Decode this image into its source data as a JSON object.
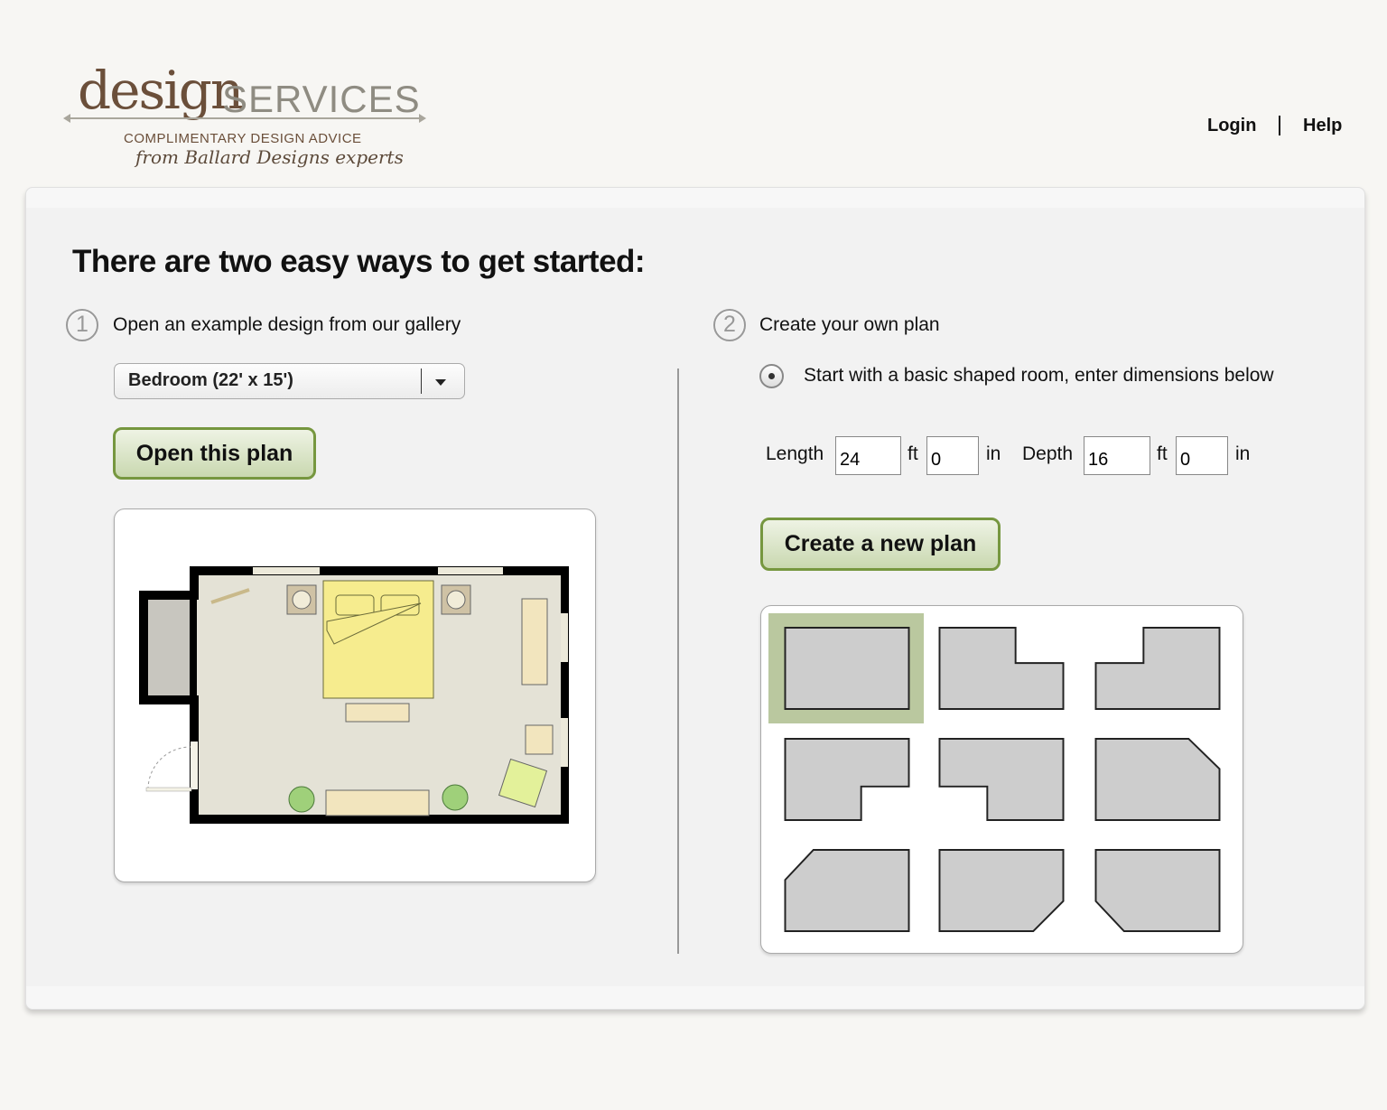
{
  "header": {
    "logo": {
      "word1": "design",
      "word2": "SERVICES",
      "tagline": "COMPLIMENTARY DESIGN ADVICE",
      "from": "from Ballard Designs experts"
    },
    "login": "Login",
    "help": "Help"
  },
  "main": {
    "title": "There are two easy ways to get started:",
    "option1": {
      "number": "1",
      "label": "Open an example design from our gallery",
      "select_value": "Bedroom (22' x 15')",
      "button": "Open this plan"
    },
    "option2": {
      "number": "2",
      "label": "Create your own plan",
      "radio_label": "Start with a basic shaped room, enter dimensions below",
      "length_label": "Length",
      "length_ft": "24",
      "length_in": "0",
      "depth_label": "Depth",
      "depth_ft": "16",
      "depth_in": "0",
      "ft": "ft",
      "in": "in",
      "button": "Create a new plan",
      "shapes": [
        "rectangle",
        "l-shape-notch-top-right",
        "l-shape-notch-top-left",
        "l-shape-notch-bottom-right",
        "l-shape-notch-bottom-left",
        "angled-top-right",
        "angled-top-left",
        "angled-bottom-right",
        "angled-bottom-left"
      ],
      "selected_shape": "rectangle"
    }
  },
  "colors": {
    "button_border": "#76973f",
    "selected_shape": "#bac89f",
    "logo_brown": "#6b4f3a"
  }
}
